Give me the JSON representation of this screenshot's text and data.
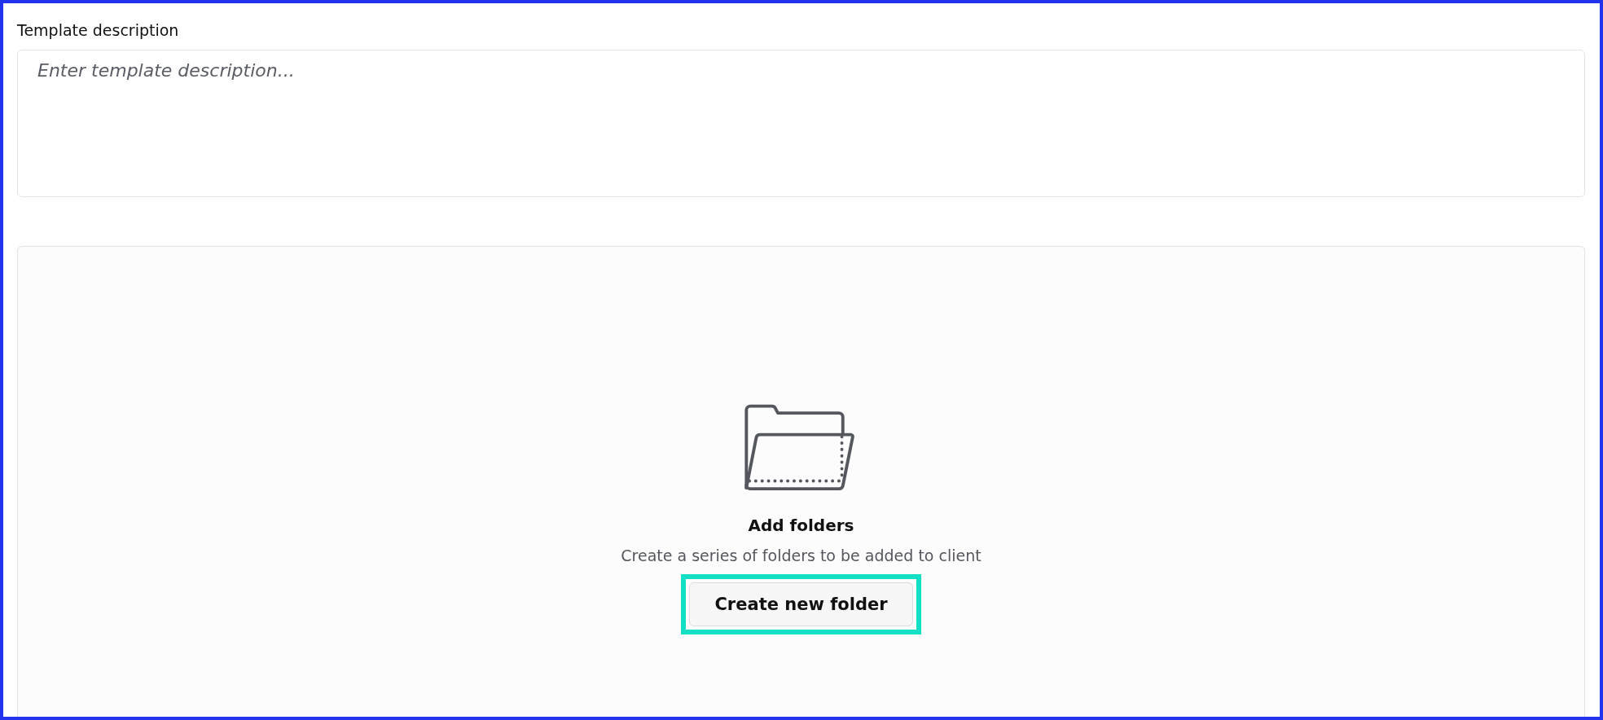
{
  "description": {
    "label": "Template description",
    "placeholder": "Enter template description..."
  },
  "empty_state": {
    "title": "Add folders",
    "subtitle": "Create a series of folders to be added to client",
    "button": {
      "label": "Create new folder",
      "highlighted": true
    }
  }
}
